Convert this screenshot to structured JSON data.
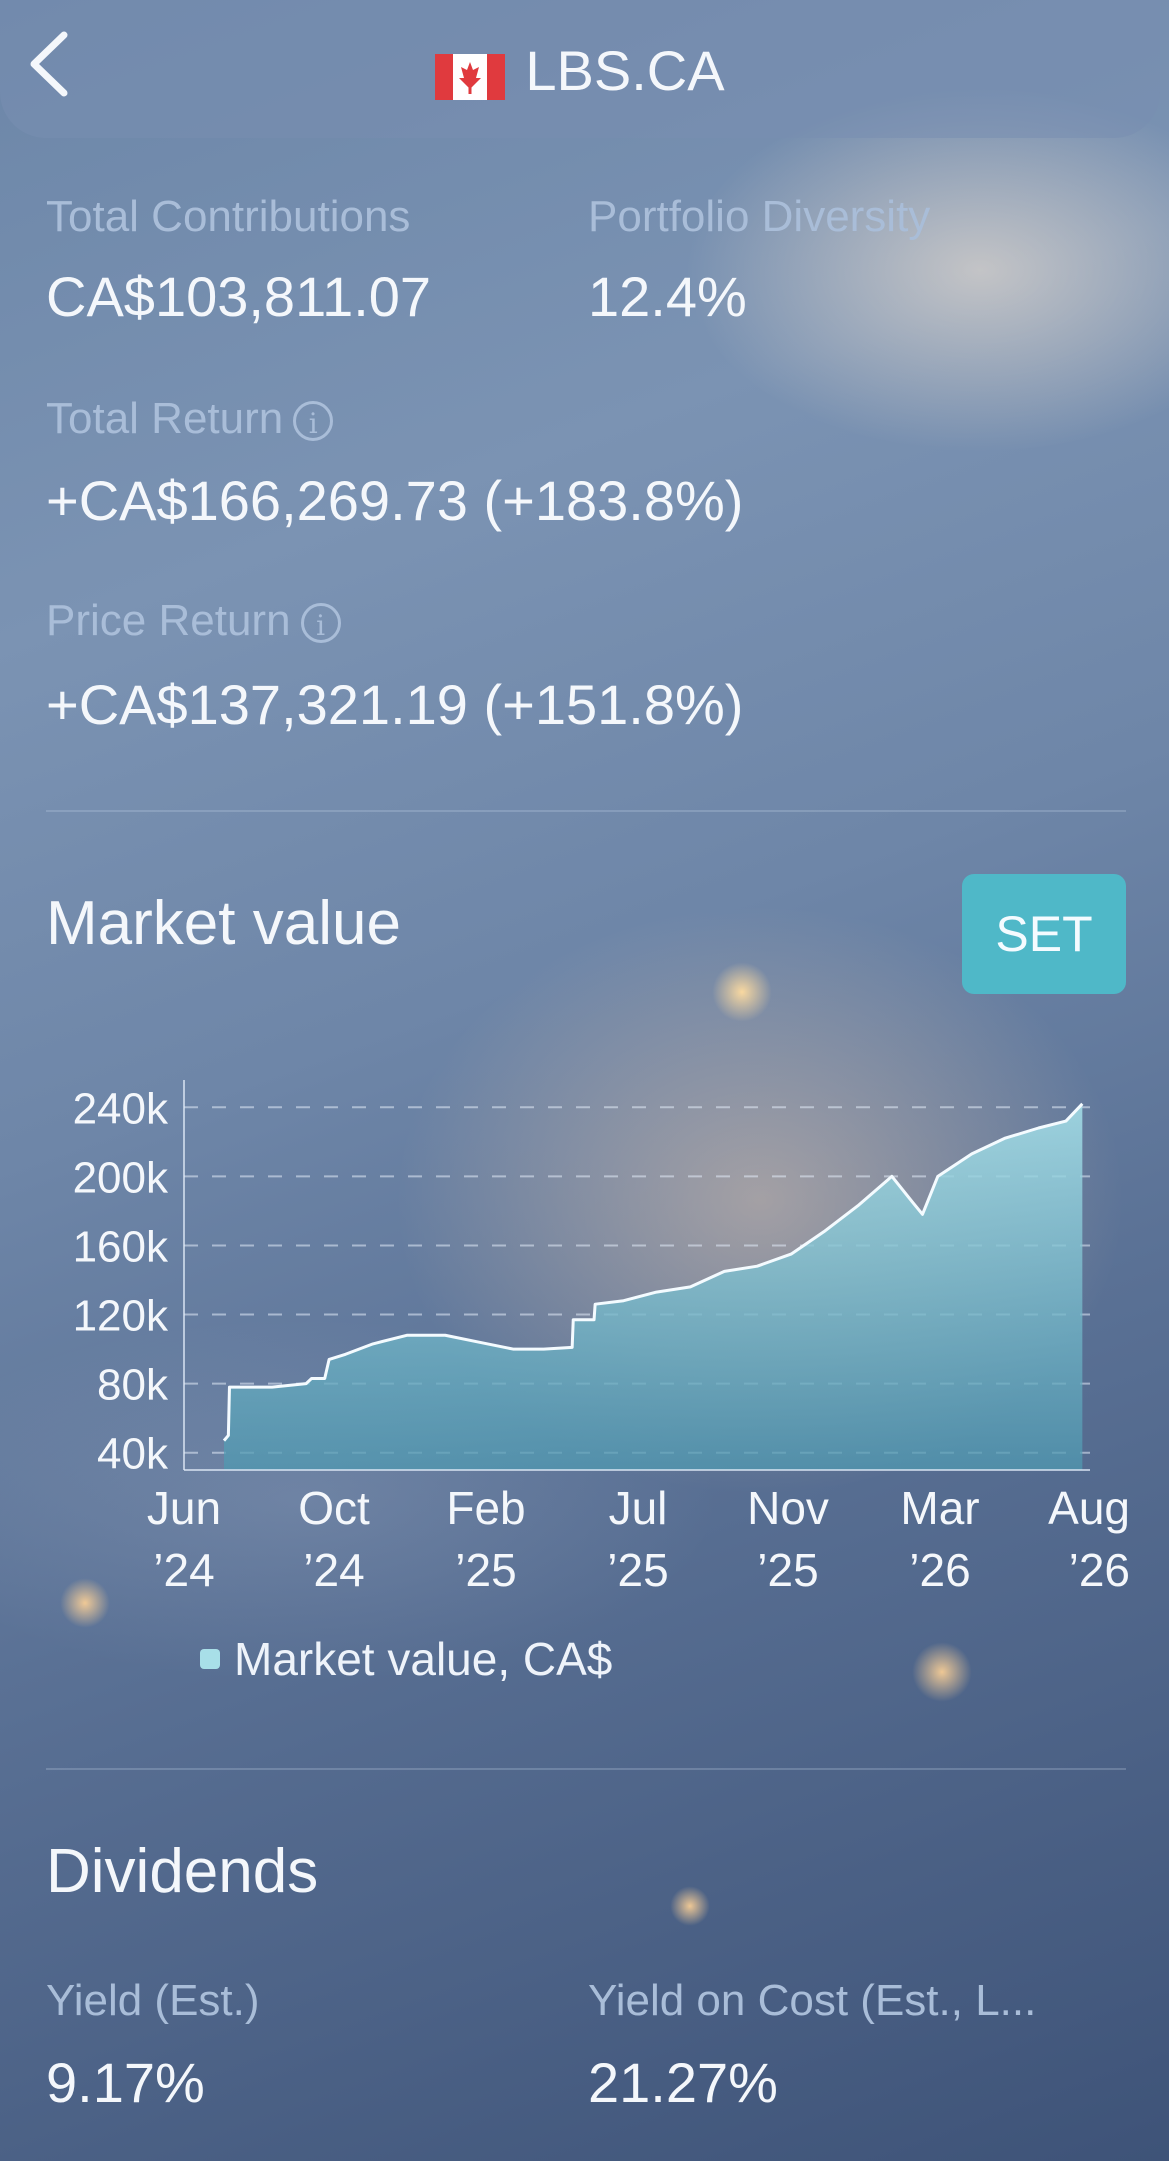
{
  "header": {
    "title": "LBS.CA",
    "flag": "canada-flag-icon"
  },
  "stats": {
    "total_contributions": {
      "label": "Total Contributions",
      "value": "CA$103,811.07"
    },
    "portfolio_diversity": {
      "label": "Portfolio Diversity",
      "value": "12.4%"
    },
    "total_return": {
      "label": "Total Return",
      "value": "+CA$166,269.73 (+183.8%)"
    },
    "price_return": {
      "label": "Price Return",
      "value": "+CA$137,321.19 (+151.8%)"
    }
  },
  "market": {
    "title": "Market value",
    "set_label": "SET",
    "legend": "Market value, CA$"
  },
  "dividends": {
    "title": "Dividends",
    "yield_label": "Yield (Est.)",
    "yield_value": "9.17%",
    "yoc_label": "Yield on Cost (Est., L...",
    "yoc_value": "21.27%"
  },
  "colors": {
    "accent": "#4fb8c8",
    "area": "#8fd0dc",
    "line": "#f4fbff"
  },
  "chart_data": {
    "type": "area",
    "y_ticks": [
      "240k",
      "200k",
      "160k",
      "120k",
      "80k",
      "40k"
    ],
    "y_tick_values": [
      240000,
      200000,
      160000,
      120000,
      80000,
      40000
    ],
    "x_ticks": [
      "Jun\n’24",
      "Oct\n’24",
      "Feb\n’25",
      "Jul\n’25",
      "Nov\n’25",
      "Mar\n’26",
      "Aug\n’26"
    ],
    "x_tick_lines": [
      [
        "Jun",
        "’24"
      ],
      [
        "Oct",
        "’24"
      ],
      [
        "Feb",
        "’25"
      ],
      [
        "Jul",
        "’25"
      ],
      [
        "Nov",
        "’25"
      ],
      [
        "Mar",
        "’26"
      ],
      [
        "Aug",
        "’26"
      ]
    ],
    "ylim": [
      30000,
      250000
    ],
    "grid": true,
    "legend_position": "bottom",
    "series": [
      {
        "name": "Market value, CA$",
        "points": [
          [
            "2024-06-01",
            47000
          ],
          [
            "2024-06-05",
            50000
          ],
          [
            "2024-06-06",
            78000
          ],
          [
            "2024-07-15",
            78000
          ],
          [
            "2024-08-15",
            80000
          ],
          [
            "2024-08-20",
            83000
          ],
          [
            "2024-09-01",
            83000
          ],
          [
            "2024-09-05",
            94000
          ],
          [
            "2024-09-20",
            97000
          ],
          [
            "2024-10-15",
            103000
          ],
          [
            "2024-11-15",
            108000
          ],
          [
            "2024-12-20",
            108000
          ],
          [
            "2025-01-20",
            104000
          ],
          [
            "2025-02-20",
            100000
          ],
          [
            "2025-03-20",
            100000
          ],
          [
            "2025-04-15",
            101000
          ],
          [
            "2025-04-16",
            117000
          ],
          [
            "2025-05-05",
            117000
          ],
          [
            "2025-05-06",
            126000
          ],
          [
            "2025-06-01",
            128000
          ],
          [
            "2025-07-01",
            133000
          ],
          [
            "2025-08-01",
            136000
          ],
          [
            "2025-09-01",
            145000
          ],
          [
            "2025-10-01",
            148000
          ],
          [
            "2025-11-01",
            155000
          ],
          [
            "2025-12-01",
            168000
          ],
          [
            "2026-01-01",
            183000
          ],
          [
            "2026-02-01",
            200000
          ],
          [
            "2026-02-20",
            185000
          ],
          [
            "2026-03-01",
            178000
          ],
          [
            "2026-03-15",
            200000
          ],
          [
            "2026-04-15",
            213000
          ],
          [
            "2026-05-15",
            222000
          ],
          [
            "2026-06-15",
            228000
          ],
          [
            "2026-07-10",
            232000
          ],
          [
            "2026-07-25",
            242000
          ]
        ]
      }
    ]
  }
}
